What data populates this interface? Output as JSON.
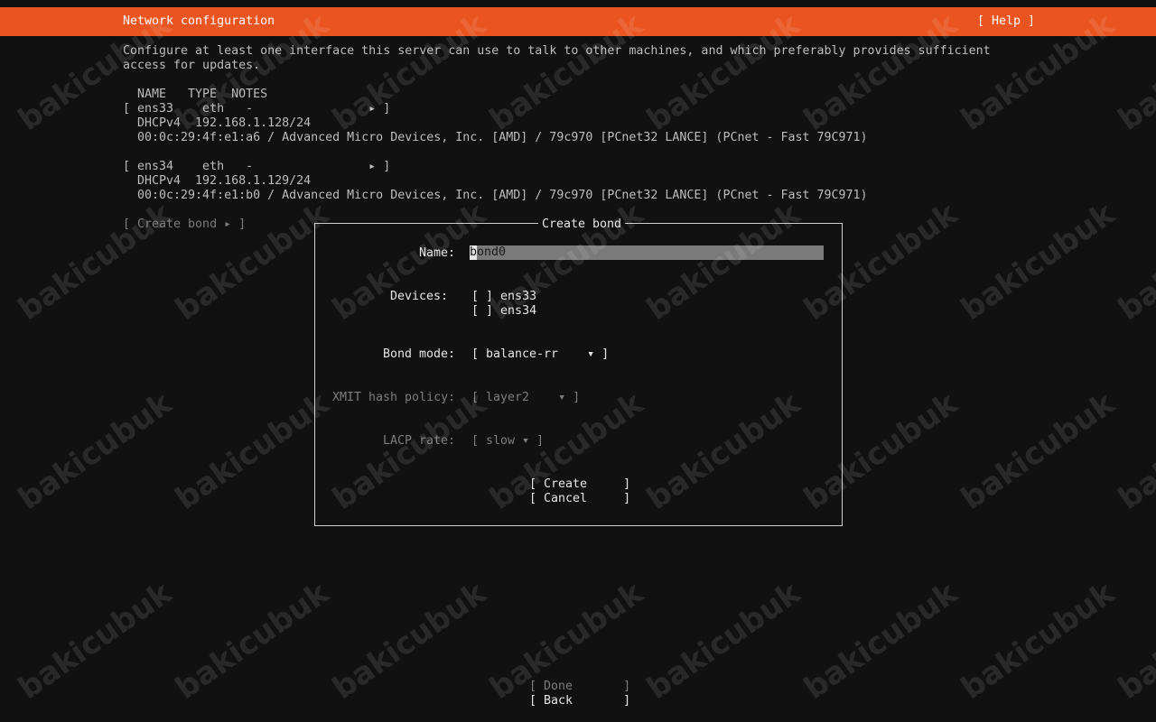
{
  "header": {
    "title": "Network configuration",
    "help": "[ Help ]"
  },
  "intro": {
    "line1": "Configure at least one interface this server can use to talk to other machines, and which preferably provides sufficient",
    "line2": "access for updates."
  },
  "table": {
    "header": "NAME   TYPE  NOTES",
    "interfaces": [
      {
        "row": "[ ens33    eth   -                ▸ ]",
        "dhcp": "DHCPv4  192.168.1.128/24",
        "hw": "00:0c:29:4f:e1:a6 / Advanced Micro Devices, Inc. [AMD] / 79c970 [PCnet32 LANCE] (PCnet - Fast 79C971)"
      },
      {
        "row": "[ ens34    eth   -                ▸ ]",
        "dhcp": "DHCPv4  192.168.1.129/24",
        "hw": "00:0c:29:4f:e1:b0 / Advanced Micro Devices, Inc. [AMD] / 79c970 [PCnet32 LANCE] (PCnet - Fast 79C971)"
      }
    ],
    "create_bond": "[ Create bond ▸ ]"
  },
  "dialog": {
    "title": "Create bond",
    "name_label": "Name:",
    "name_value": "ond0",
    "name_first_char": "b",
    "devices_label": "Devices:",
    "devices": [
      {
        "box": "[ ]",
        "name": "ens33"
      },
      {
        "box": "[ ]",
        "name": "ens34"
      }
    ],
    "bond_mode_label": "Bond mode:",
    "bond_mode_value": "[ balance-rr    ▾ ]",
    "xmit_label": "XMIT hash policy:",
    "xmit_value": "[ layer2    ▾ ]",
    "lacp_label": "LACP rate:",
    "lacp_value": "[ slow ▾ ]",
    "create_button": "[ Create     ]",
    "cancel_button": "[ Cancel     ]"
  },
  "footer": {
    "done_button": "[ Done       ]",
    "back_button": "[ Back       ]"
  },
  "watermark": "bakicubuk",
  "colors": {
    "accent": "#e95420",
    "background": "#111111",
    "text": "#bdbdbd"
  }
}
